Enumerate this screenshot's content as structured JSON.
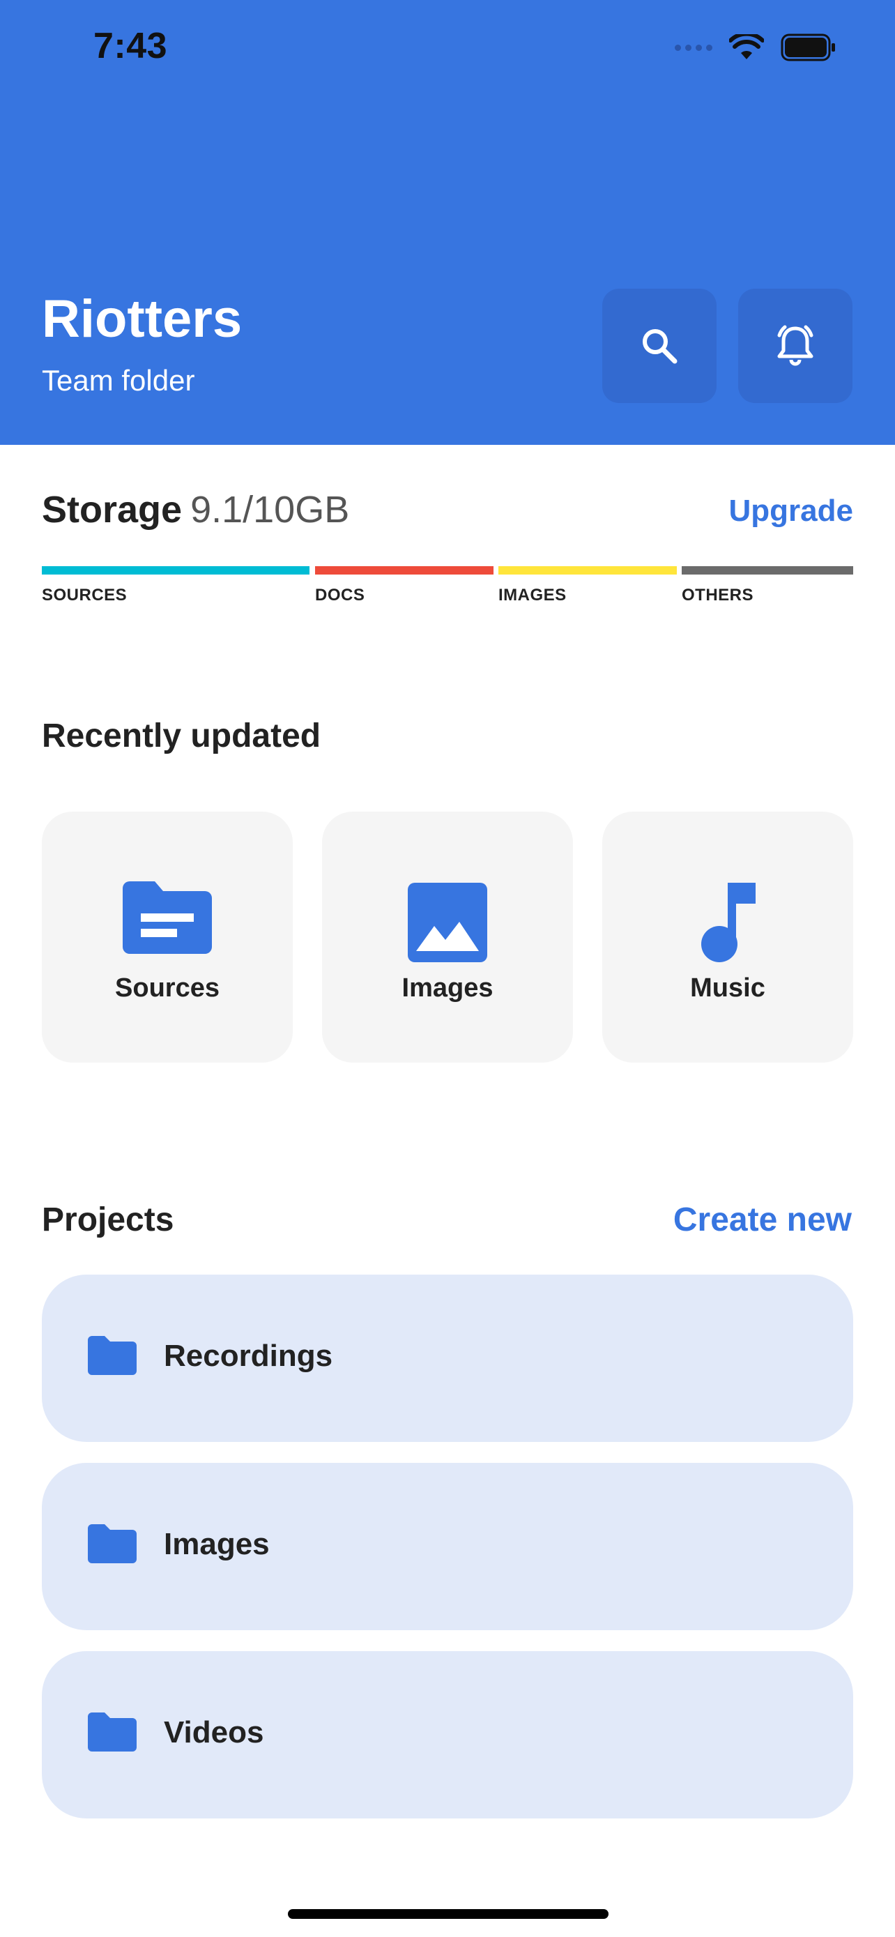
{
  "status_bar": {
    "time": "7:43"
  },
  "header": {
    "title": "Riotters",
    "subtitle": "Team folder",
    "icons": [
      "search-icon",
      "bell-icon"
    ]
  },
  "storage": {
    "label": "Storage",
    "usage": "9.1/10GB",
    "upgrade_label": "Upgrade",
    "categories": [
      {
        "label": "SOURCES",
        "color": "#00BCD4"
      },
      {
        "label": "DOCS",
        "color": "#EE4B3A"
      },
      {
        "label": "IMAGES",
        "color": "#FFE53B"
      },
      {
        "label": "OTHERS",
        "color": "#6B6B6B"
      }
    ]
  },
  "recent": {
    "title": "Recently updated",
    "items": [
      {
        "label": "Sources",
        "icon": "folder-doc-icon"
      },
      {
        "label": "Images",
        "icon": "image-icon"
      },
      {
        "label": "Music",
        "icon": "music-note-icon"
      }
    ]
  },
  "projects": {
    "title": "Projects",
    "create_label": "Create new",
    "items": [
      {
        "label": "Recordings",
        "icon": "folder-icon"
      },
      {
        "label": "Images",
        "icon": "folder-icon"
      },
      {
        "label": "Videos",
        "icon": "folder-icon"
      }
    ]
  },
  "colors": {
    "accent": "#3775E0",
    "header_button": "#336AD0",
    "card_bg": "#F5F5F5",
    "project_bg": "#E1E9F9"
  }
}
